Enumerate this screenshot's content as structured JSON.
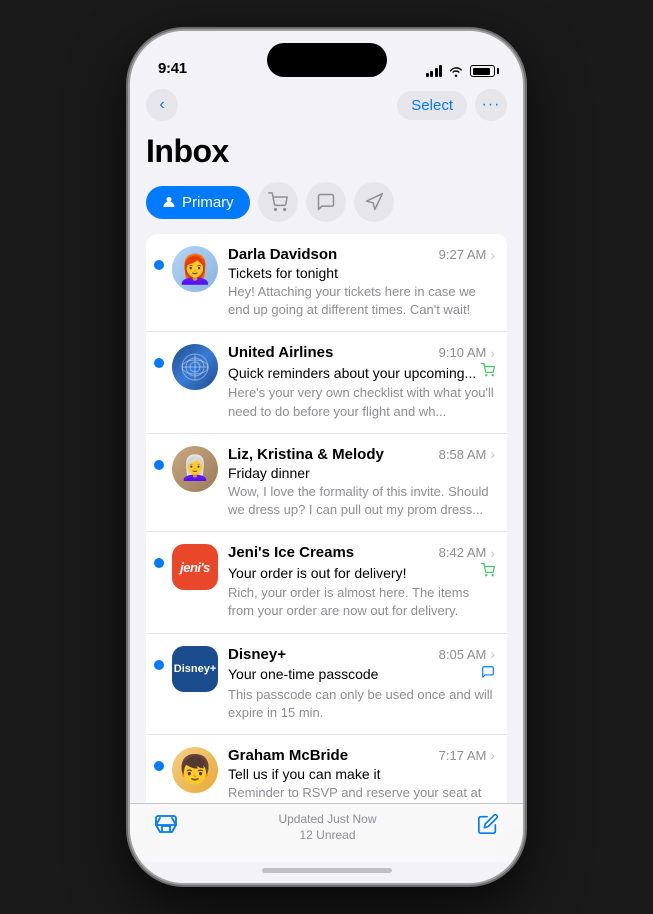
{
  "status_bar": {
    "time": "9:41",
    "signal": "signal",
    "wifi": "wifi",
    "battery": "battery"
  },
  "nav": {
    "back_label": "‹",
    "select_label": "Select",
    "more_label": "···"
  },
  "header": {
    "title": "Inbox"
  },
  "filter_tabs": [
    {
      "id": "primary",
      "label": "Primary",
      "active": true
    },
    {
      "id": "shopping",
      "label": "Shopping",
      "active": false
    },
    {
      "id": "social",
      "label": "Social",
      "active": false
    },
    {
      "id": "updates",
      "label": "Updates",
      "active": false
    }
  ],
  "emails": [
    {
      "id": 1,
      "sender": "Darla Davidson",
      "subject": "Tickets for tonight",
      "preview": "Hey! Attaching your tickets here in case we end up going at different times. Can't wait!",
      "time": "9:27 AM",
      "unread": true,
      "avatar_type": "darla",
      "tag_icon": null
    },
    {
      "id": 2,
      "sender": "United Airlines",
      "subject": "Quick reminders about your upcoming...",
      "preview": "Here's your very own checklist with what you'll need to do before your flight and wh...",
      "time": "9:10 AM",
      "unread": true,
      "avatar_type": "united",
      "tag_icon": "shopping"
    },
    {
      "id": 3,
      "sender": "Liz, Kristina & Melody",
      "subject": "Friday dinner",
      "preview": "Wow, I love the formality of this invite. Should we dress up? I can pull out my prom dress...",
      "time": "8:58 AM",
      "unread": true,
      "avatar_type": "liz",
      "tag_icon": null
    },
    {
      "id": 4,
      "sender": "Jeni's Ice Creams",
      "subject": "Your order is out for delivery!",
      "preview": "Rich, your order is almost here. The items from your order are now out for delivery.",
      "time": "8:42 AM",
      "unread": true,
      "avatar_type": "jenis",
      "tag_icon": "shopping"
    },
    {
      "id": 5,
      "sender": "Disney+",
      "subject": "Your one-time passcode",
      "preview": "This passcode can only be used once and will expire in 15 min.",
      "time": "8:05 AM",
      "unread": true,
      "avatar_type": "disney",
      "tag_icon": "message"
    },
    {
      "id": 6,
      "sender": "Graham McBride",
      "subject": "Tell us if you can make it",
      "preview": "Reminder to RSVP and reserve your seat at",
      "time": "7:17 AM",
      "unread": true,
      "avatar_type": "graham",
      "tag_icon": null
    }
  ],
  "bottom_bar": {
    "updated_label": "Updated Just Now",
    "unread_label": "12 Unread"
  }
}
